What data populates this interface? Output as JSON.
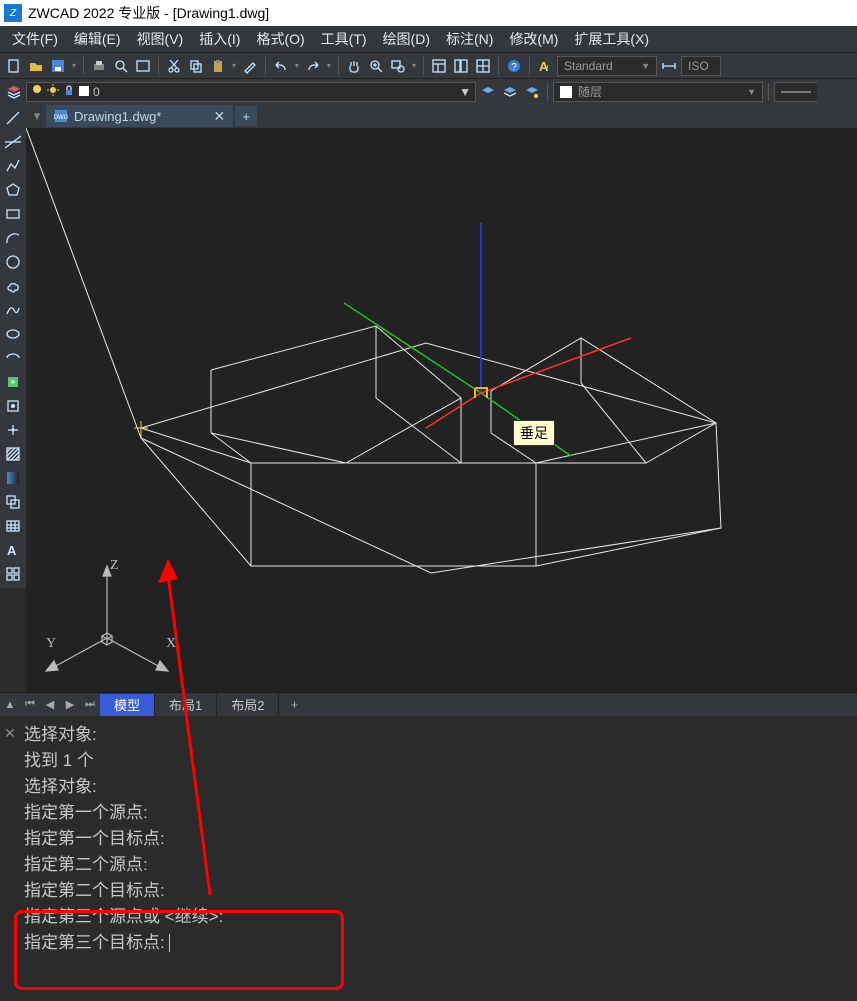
{
  "titlebar": {
    "title": "ZWCAD 2022 专业版 - [Drawing1.dwg]"
  },
  "menu": {
    "items": [
      {
        "label": "文件(F)"
      },
      {
        "label": "编辑(E)"
      },
      {
        "label": "视图(V)"
      },
      {
        "label": "插入(I)"
      },
      {
        "label": "格式(O)"
      },
      {
        "label": "工具(T)"
      },
      {
        "label": "绘图(D)"
      },
      {
        "label": "标注(N)"
      },
      {
        "label": "修改(M)"
      },
      {
        "label": "扩展工具(X)"
      }
    ]
  },
  "toolbar1": {
    "text_style": "Standard",
    "dim_style": "ISO"
  },
  "layers": {
    "current": "0",
    "bylayer": "随层"
  },
  "file_tabs": {
    "tab1": "Drawing1.dwg*"
  },
  "view_tabs": {
    "model": "模型",
    "layout1": "布局1",
    "layout2": "布局2"
  },
  "tooltip": {
    "text": "垂足"
  },
  "ucs": {
    "x": "X",
    "y": "Y",
    "z": "Z"
  },
  "cmd": {
    "lines": [
      "选择对象:",
      "找到 1 个",
      "选择对象:",
      "指定第一个源点:",
      "指定第一个目标点:",
      "指定第二个源点:",
      "指定第二个目标点:",
      "指定第三个源点或 <继续>:",
      "",
      "指定第三个目标点: "
    ]
  }
}
